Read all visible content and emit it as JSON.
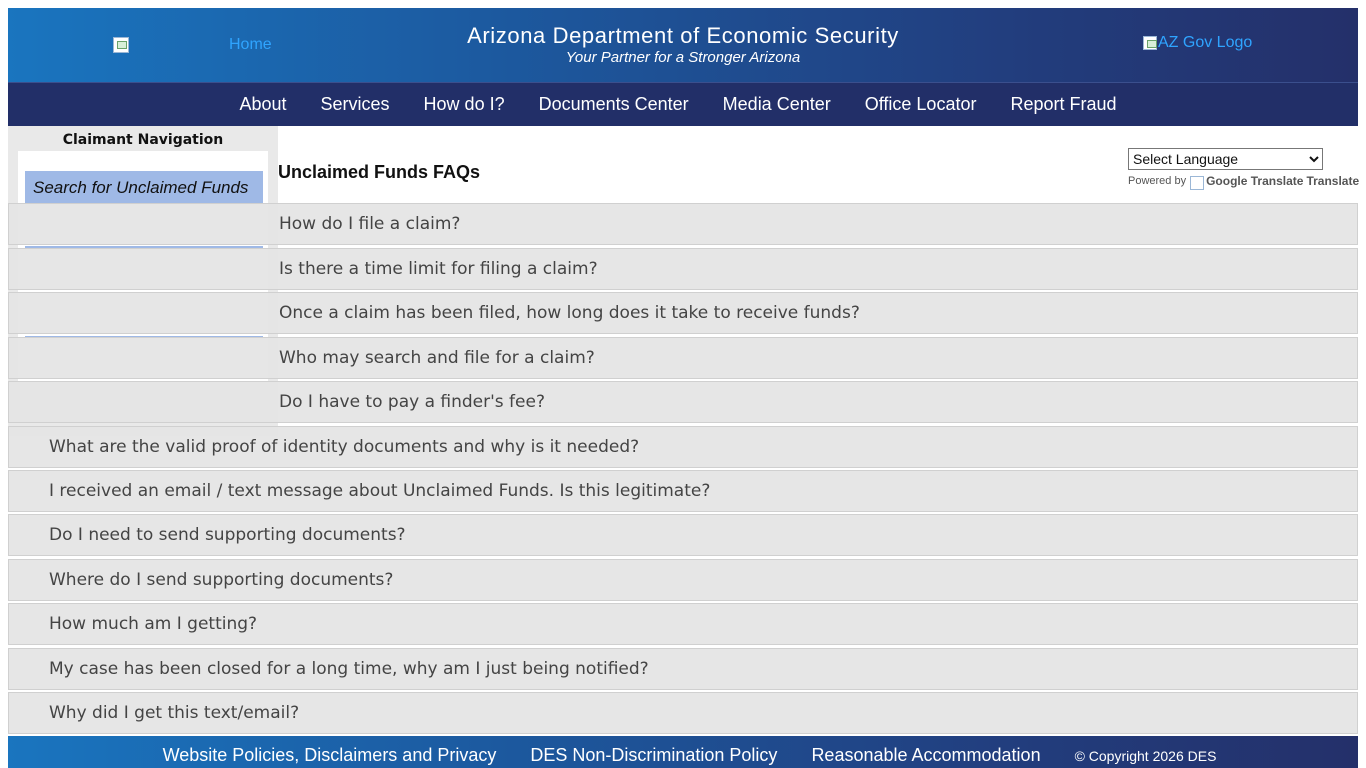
{
  "header": {
    "home_label": "Home",
    "title": "Arizona Department of Economic Security",
    "tagline": "Your Partner for a Stronger Arizona",
    "gov_logo_alt": "AZ Gov Logo"
  },
  "nav": {
    "items": [
      "About",
      "Services",
      "How do I?",
      "Documents Center",
      "Media Center",
      "Office Locator",
      "Report Fraud"
    ]
  },
  "sidebar": {
    "title": "Claimant Navigation",
    "active_item": "Search for Unclaimed Funds"
  },
  "main": {
    "heading": "Unclaimed Funds FAQs",
    "translate": {
      "selected": "Select Language",
      "powered_by": "Powered by",
      "brand": "Google Translate",
      "link": "Translate"
    },
    "faqs": [
      "How do I file a claim?",
      "Is there a time limit for filing a claim?",
      "Once a claim has been filed, how long does it take to receive funds?",
      "Who may search and file for a claim?",
      "Do I have to pay a finder's fee?",
      "What are the valid proof of identity documents and why is it needed?",
      "I received an email / text message about Unclaimed Funds. Is this legitimate?",
      "Do I need to send supporting documents?",
      "Where do I send supporting documents?",
      "How much am I getting?",
      "My case has been closed for a long time, why am I just being notified?",
      "Why did I get this text/email?"
    ]
  },
  "footer": {
    "links": [
      "Website Policies, Disclaimers and Privacy",
      "DES Non-Discrimination Policy",
      "Reasonable Accommodation"
    ],
    "copyright": "© Copyright 2026 DES"
  },
  "colors": {
    "header_start": "#1a75bf",
    "header_end": "#24306a",
    "nav_bg": "#222f68",
    "sidebar_active": "#9fb9e6",
    "faq_bg": "#e4e4e4"
  }
}
